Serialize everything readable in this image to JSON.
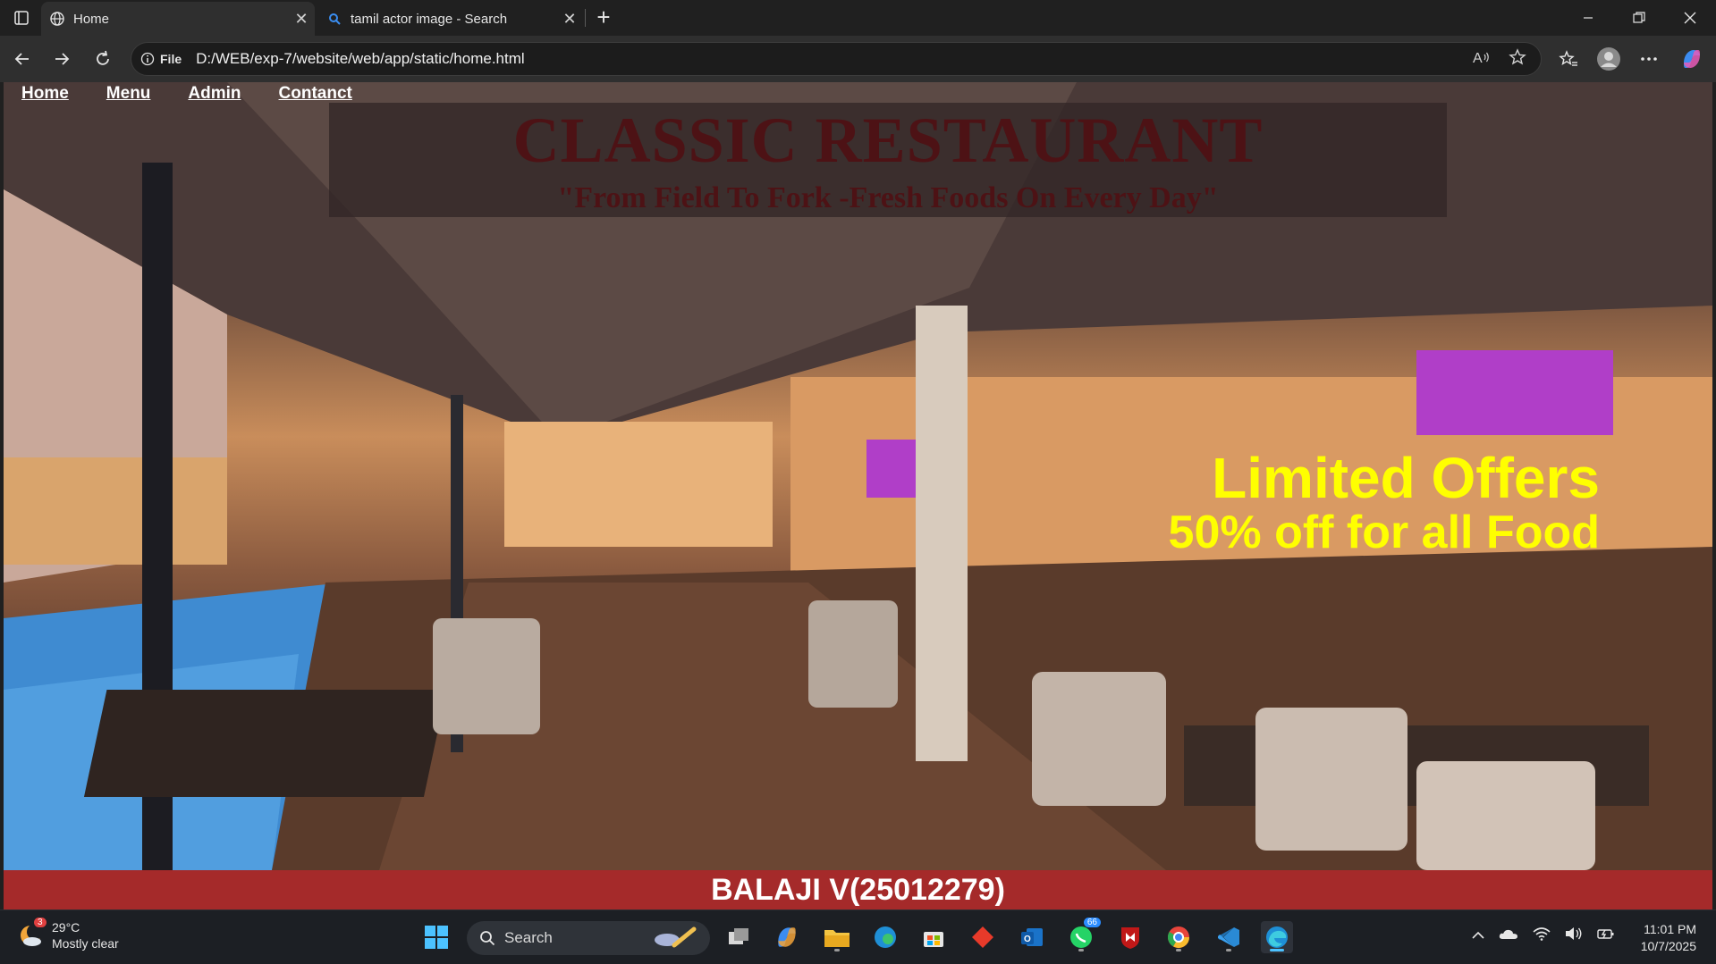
{
  "browser": {
    "tabs": [
      {
        "title": "Home",
        "active": true,
        "icon": "globe-icon"
      },
      {
        "title": "tamil actor image - Search",
        "active": false,
        "icon": "search-icon"
      }
    ],
    "address": {
      "security_label": "File",
      "url": "D:/WEB/exp-7/website/web/app/static/home.html"
    }
  },
  "page": {
    "nav": [
      "Home",
      "Menu",
      "Admin",
      "Contanct"
    ],
    "title": "CLASSIC RESTAURANT",
    "tagline": "\"From Field To Fork -Fresh Foods On Every Day\"",
    "offer_heading": "Limited Offers",
    "offer_sub": "50% off for all Food",
    "footer": "BALAJI V(25012279)",
    "colors": {
      "title": "#4d1215",
      "offer": "#ffff00",
      "footer_bg": "#a52a2a"
    }
  },
  "taskbar": {
    "weather": {
      "temp": "29°C",
      "condition": "Mostly clear",
      "badge": "3"
    },
    "search_label": "Search",
    "whatsapp_badge": "66",
    "clock": {
      "time": "11:01 PM",
      "date": "10/7/2025"
    }
  }
}
